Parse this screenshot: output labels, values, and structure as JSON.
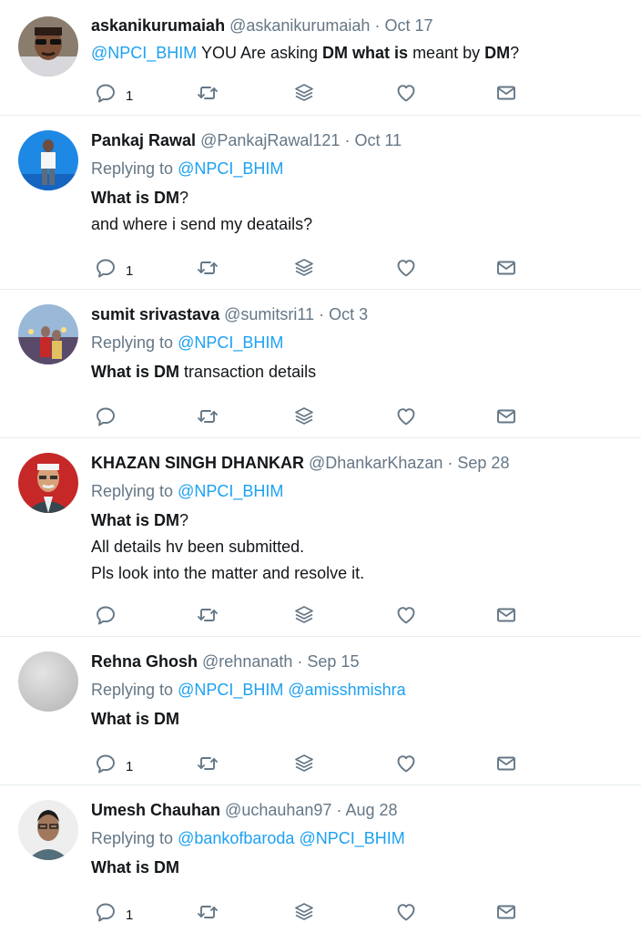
{
  "tweets": [
    {
      "name": "askanikurumaiah",
      "handle": "@askanikurumaiah",
      "sep": "·",
      "time": "Oct 17",
      "body": {
        "mention": "@NPCI_BHIM",
        "t1": " YOU Are asking ",
        "b1": "DM",
        "t2": " ",
        "b2": "what is",
        "t3": " meant by ",
        "b3": "DM",
        "t4": "?"
      },
      "reply_count": "1"
    },
    {
      "name": "Pankaj Rawal",
      "handle": "@PankajRawal121",
      "sep": "·",
      "time": "Oct 11",
      "replying_label": "Replying to",
      "replying_to": [
        "@NPCI_BHIM"
      ],
      "bold": "What is DM",
      "after_bold": "?",
      "lines": [
        "and where i send my deatails?"
      ],
      "reply_count": "1"
    },
    {
      "name": "sumit srivastava",
      "handle": "@sumitsri11",
      "sep": "·",
      "time": "Oct 3",
      "replying_label": "Replying to",
      "replying_to": [
        "@NPCI_BHIM"
      ],
      "bold": "What is DM",
      "after_bold": " transaction details",
      "lines": [],
      "reply_count": ""
    },
    {
      "name": "KHAZAN SINGH DHANKAR",
      "handle": "@DhankarKhazan",
      "sep": "·",
      "time": "Sep 28",
      "replying_label": "Replying to",
      "replying_to": [
        "@NPCI_BHIM"
      ],
      "bold": "What is DM",
      "after_bold": "?",
      "lines": [
        "All details hv been submitted.",
        "Pls look into the matter and resolve it."
      ],
      "reply_count": ""
    },
    {
      "name": "Rehna Ghosh",
      "handle": "@rehnanath",
      "sep": "·",
      "time": "Sep 15",
      "replying_label": "Replying to",
      "replying_to": [
        "@NPCI_BHIM",
        "@amisshmishra"
      ],
      "bold": "What is DM",
      "after_bold": "",
      "lines": [],
      "reply_count": "1"
    },
    {
      "name": "Umesh Chauhan",
      "handle": "@uchauhan97",
      "sep": "·",
      "time": "Aug 28",
      "replying_label": "Replying to",
      "replying_to": [
        "@bankofbaroda",
        "@NPCI_BHIM"
      ],
      "bold": "What is DM",
      "after_bold": "",
      "lines": [],
      "reply_count": "1"
    }
  ],
  "icons": {
    "reply": "reply-icon",
    "retweet": "retweet-icon",
    "stack": "layers-icon",
    "like": "heart-icon",
    "dm": "envelope-icon"
  },
  "colors": {
    "text": "#14171a",
    "muted": "#657786",
    "link": "#1da1f2",
    "divider": "#e6ecf0"
  }
}
